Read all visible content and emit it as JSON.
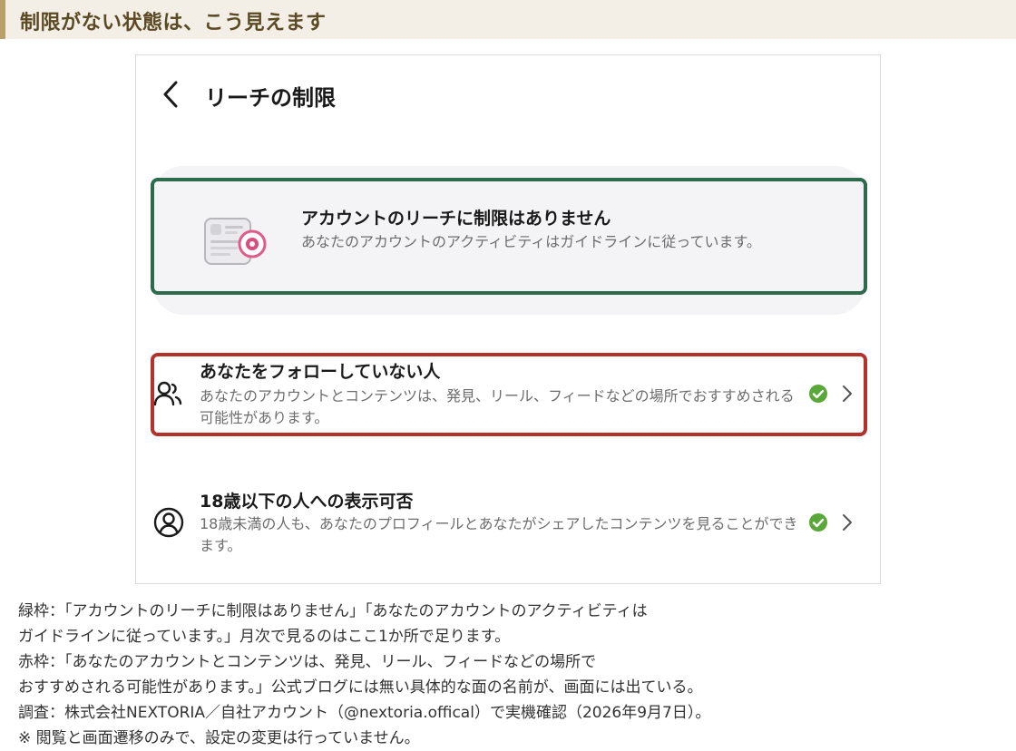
{
  "banner": {
    "title": "制限がない状態は、こう見えます"
  },
  "screen": {
    "title": "リーチの制限",
    "status": {
      "heading": "アカウントのリーチに制限はありません",
      "body": "あなたのアカウントのアクティビティはガイドラインに従っています。"
    },
    "rows": [
      {
        "heading": "あなたをフォローしていない人",
        "body": "あなたのアカウントとコンテンツは、発見、リール、フィードなどの場所でおすすめされる可能性があります。",
        "icon": "people-icon",
        "checked": true
      },
      {
        "heading": "18歳以下の人への表示可否",
        "body": "18歳未満の人も、あなたのプロフィールとあなたがシェアしたコンテンツを見ることができます。",
        "icon": "person-circle-icon",
        "checked": true
      }
    ]
  },
  "notes": {
    "lines": [
      "緑枠：「アカウントのリーチに制限はありません」「あなたのアカウントのアクティビティは",
      "ガイドラインに従っています。」月次で見るのはここ1か所で足ります。",
      "赤枠：「あなたのアカウントとコンテンツは、発見、リール、フィードなどの場所で",
      "おすすめされる可能性があります。」公式ブログには無い具体的な面の名前が、画面には出ている。",
      "調査：株式会社NEXTORIA／自社アカウント（@nextoria.offical）で実機確認（2026年9月7日）。",
      "※ 閲覧と画面遷移のみで、設定の変更は行っていません。"
    ]
  },
  "colors": {
    "green_frame": "#2e6a4c",
    "red_frame": "#b3322b",
    "check_green": "#5aa83a",
    "banner_bg": "#f3efe6",
    "banner_text": "#5b4a24"
  }
}
